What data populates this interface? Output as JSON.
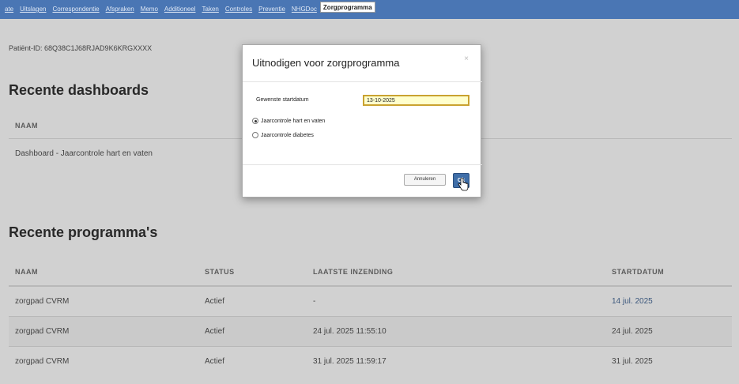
{
  "nav": {
    "tabs": [
      "ate",
      "Uitslagen",
      "Correspondentie",
      "Afspraken",
      "Memo",
      "Additioneel",
      "Taken",
      "Controles",
      "Preventie",
      "NHGDoc",
      "Zorgprogramma"
    ],
    "active_tab": "Zorgprogramma"
  },
  "patient": {
    "id_text": "Patiënt-ID: 68Q38C1J68RJAD9K6KRGXXXX"
  },
  "dashboards": {
    "title": "Recente dashboards",
    "header": "NAAM",
    "rows": [
      "Dashboard - Jaarcontrole hart en vaten"
    ]
  },
  "programs": {
    "title": "Recente programma's",
    "headers": [
      "NAAM",
      "STATUS",
      "LAATSTE INZENDING",
      "STARTDATUM"
    ],
    "rows": [
      [
        "zorgpad CVRM",
        "Actief",
        "-",
        "14 jul. 2025"
      ],
      [
        "zorgpad CVRM",
        "Actief",
        "24 jul. 2025 11:55:10",
        "24 jul. 2025"
      ],
      [
        "zorgpad CVRM",
        "Actief",
        "31 jul. 2025 11:59:17",
        "31 jul. 2025"
      ]
    ]
  },
  "modal": {
    "title": "Uitnodigen voor zorgprogramma",
    "close": "×",
    "start_label": "Gewenste startdatum",
    "start_value": "13-10-2025",
    "options": [
      "Jaarcontrole hart en vaten",
      "Jaarcontrole diabetes"
    ],
    "selected_option": 0,
    "cancel_label": "Annuleren",
    "ok_label": "Ok"
  },
  "colors": {
    "nav_bg": "#4a76b4",
    "ok_button": "#3f6ea8",
    "input_bg": "#ffffcc",
    "input_border": "#c9a230"
  }
}
